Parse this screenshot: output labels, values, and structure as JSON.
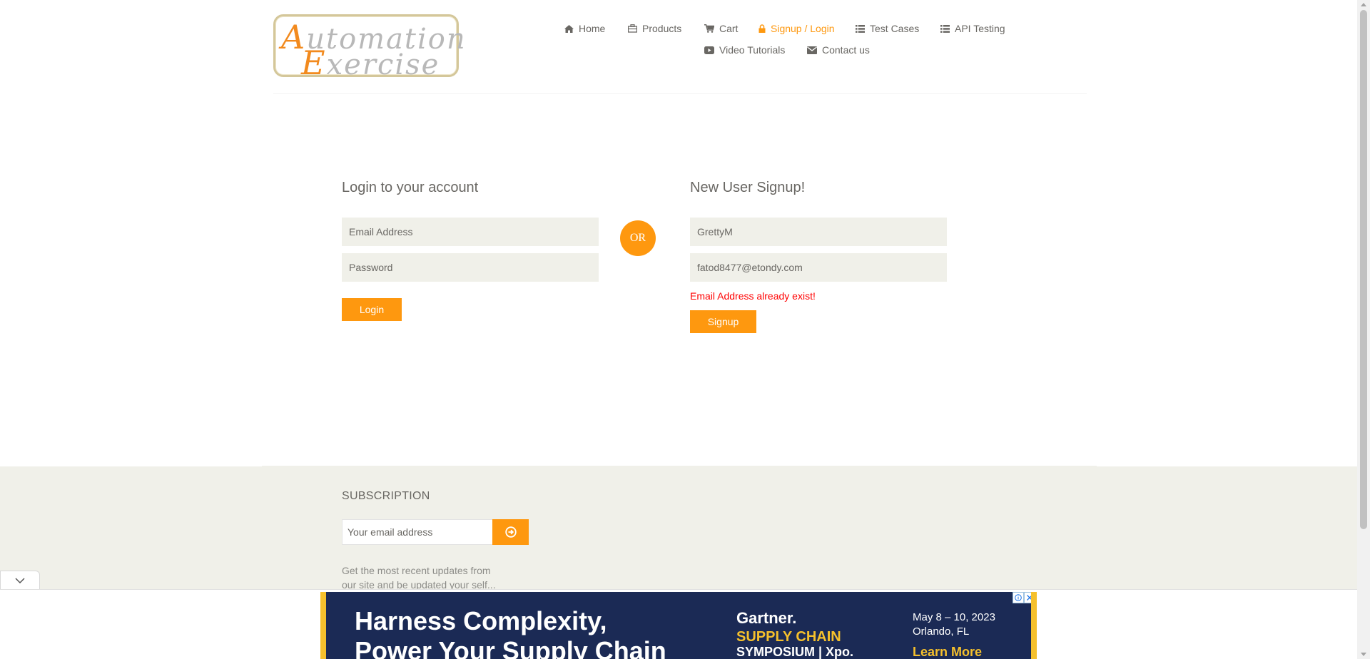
{
  "logo": {
    "line1_cap": "A",
    "line1_rest": "utomation",
    "line2_cap": "E",
    "line2_rest": "xercise"
  },
  "nav": {
    "items": [
      {
        "label": "Home",
        "icon": "home-icon"
      },
      {
        "label": "Products",
        "icon": "briefcase-icon"
      },
      {
        "label": "Cart",
        "icon": "cart-icon"
      },
      {
        "label": "Signup / Login",
        "icon": "lock-icon",
        "active": true
      },
      {
        "label": "Test Cases",
        "icon": "list-icon"
      },
      {
        "label": "API Testing",
        "icon": "list-icon"
      },
      {
        "label": "Video Tutorials",
        "icon": "youtube-icon"
      },
      {
        "label": "Contact us",
        "icon": "envelope-icon"
      }
    ]
  },
  "login": {
    "title": "Login to your account",
    "email_placeholder": "Email Address",
    "password_placeholder": "Password",
    "button": "Login"
  },
  "or_label": "OR",
  "signup": {
    "title": "New User Signup!",
    "name_value": "GrettyM",
    "email_value": "fatod8477@etondy.com",
    "error": "Email Address already exist!",
    "button": "Signup"
  },
  "footer": {
    "subscription_title": "SUBSCRIPTION",
    "email_placeholder": "Your email address",
    "description": "Get the most recent updates from our site and be updated your self..."
  },
  "ad": {
    "headline_line1": "Harness Complexity,",
    "headline_line2": "Power Your Supply Chain",
    "brand": "Gartner.",
    "event_line1": "SUPPLY CHAIN",
    "event_line2": "SYMPOSIUM | Xpo.",
    "date": "May 8 – 10, 2023",
    "location": "Orlando, FL",
    "cta": "Learn More"
  },
  "colors": {
    "accent": "#fe980f",
    "error": "#ff0000",
    "field_bg": "#f0f0e9",
    "ad_bg": "#1b2a55"
  }
}
